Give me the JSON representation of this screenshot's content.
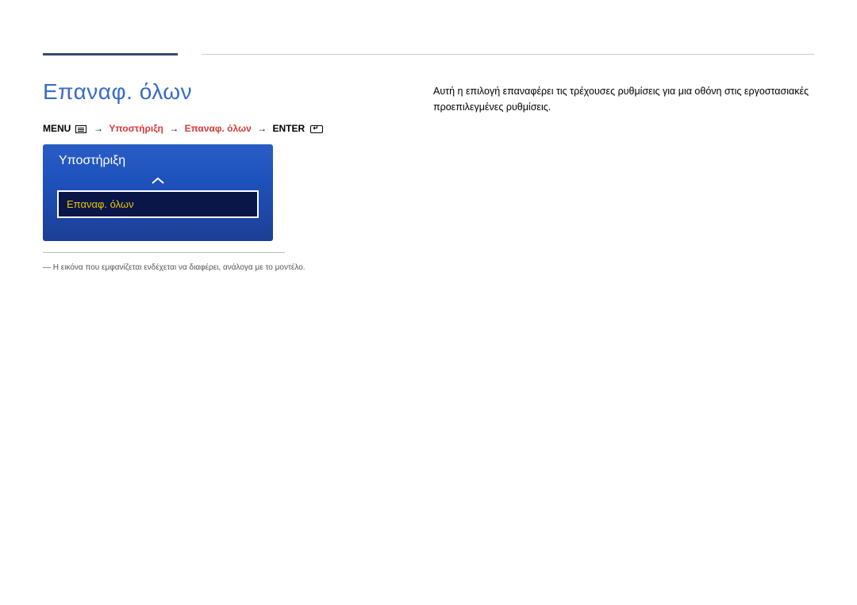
{
  "page": {
    "title": "Επαναφ. όλων",
    "footnote": "― Η εικόνα που εμφανίζεται ενδέχεται να διαφέρει, ανάλογα με το μοντέλο."
  },
  "breadcrumb": {
    "menu_label": "MENU",
    "arrow": "→",
    "crumb_support": "Υποστήριξη",
    "crumb_reset": "Επαναφ. όλων",
    "enter_label": "ENTER"
  },
  "osd": {
    "panel_title": "Υποστήριξη",
    "selected_item": "Επαναφ. όλων"
  },
  "description": {
    "text": "Αυτή η επιλογή επαναφέρει τις τρέχουσες ρυθμίσεις για μια οθόνη στις εργοστασιακές προεπιλεγμένες ρυθμίσεις."
  }
}
